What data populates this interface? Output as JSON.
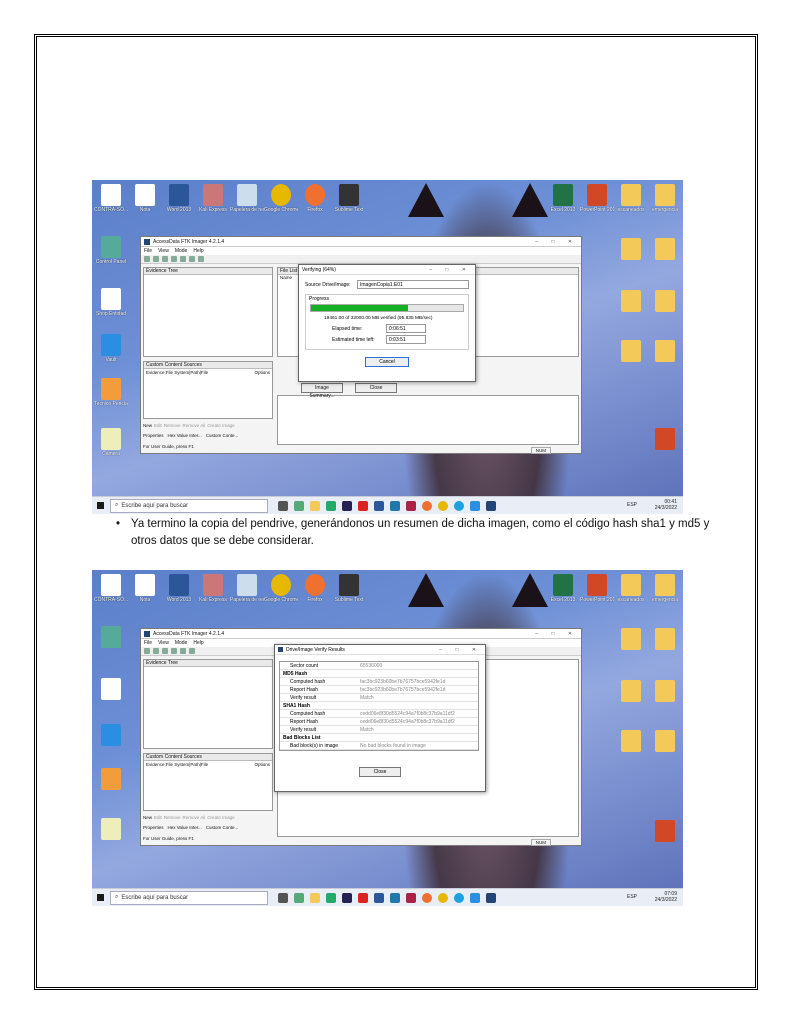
{
  "screenshot1": {
    "desktop_icons_top": [
      "CONTRA-SO...",
      "Nota",
      "Word 2013",
      "Kali Express",
      "Papelera de reciclaje",
      "Google Chrome",
      "Firefox",
      "Sublime Text"
    ],
    "desktop_icons_right": [
      "Excel 2013",
      "PowerPoint 2013",
      "escaneados",
      "emergencia"
    ],
    "left_column_icons": [
      "Control Panel",
      "Shop Entidad",
      "Vault",
      "Tecnico Pericia",
      "Camera"
    ],
    "ftk": {
      "title": "AccessData FTK Imager 4.2.1.4",
      "menu": [
        "File",
        "View",
        "Mode",
        "Help"
      ],
      "evidence_tree": "Evidence Tree",
      "custom_sources": "Custom Content Sources",
      "custom_cols": [
        "Evidence:File System|Path|File",
        "Options"
      ],
      "custom_buttons": [
        "New",
        "Edit",
        "Remove",
        "Remove All",
        "Create Image"
      ],
      "prop_tabs": [
        "Properties",
        "Hex Value Inter...",
        "Custom Conte..."
      ],
      "status": "For User Guide, press F1",
      "file_list": "File List",
      "name_col": "Name",
      "num": "NUM"
    },
    "verify_dialog": {
      "title": "Verifying (64%)",
      "source_label": "Source Drive/Image:",
      "source_value": "ImagenCopia1.E01",
      "progress_label": "Progress",
      "progress_fraction": 0.64,
      "mb_line": "19461.00 of 32000.00 MB verified (95.835 MB/sec)",
      "elapsed_label": "Elapsed time:",
      "elapsed_value": "0:06:51",
      "estimated_label": "Estimated time left:",
      "estimated_value": "0:03:51",
      "cancel": "Cancel"
    },
    "behind_buttons": [
      "Image Summary...",
      "Close"
    ],
    "taskbar": {
      "search": "Escribe aquí para buscar",
      "tray_lang": "ESP",
      "time": "00:41",
      "date": "24/3/2022"
    }
  },
  "caption": "Ya termino la copia del pendrive, generándonos un resumen de dicha imagen, como el código hash sha1 y md5 y otros datos que se debe considerar.",
  "screenshot2": {
    "ftk_title": "AccessData FTK Imager 4.2.1.4",
    "results": {
      "title": "Drive/Image Verify Results",
      "rows": [
        {
          "k": "Sector count",
          "v": "65536000",
          "group": false
        },
        {
          "k": "MD5 Hash",
          "v": "",
          "group": true
        },
        {
          "k": "Computed hash",
          "v": "fac3bc923b60be7b76757bce5942fe1d",
          "group": false
        },
        {
          "k": "Report Hash",
          "v": "fac3bc923b60be7b76757bce5942fe1d",
          "group": false
        },
        {
          "k": "Verify result",
          "v": "Match",
          "group": false
        },
        {
          "k": "SHA1 Hash",
          "v": "",
          "group": true
        },
        {
          "k": "Computed hash",
          "v": "cedd06e8f30d5524c94a7f0b8c37b9a11df2",
          "group": false
        },
        {
          "k": "Report Hash",
          "v": "cedd06e8f30d5524c94a7f0b8c37b9a11df2",
          "group": false
        },
        {
          "k": "Verify result",
          "v": "Match",
          "group": false
        },
        {
          "k": "Bad Blocks List",
          "v": "",
          "group": true
        },
        {
          "k": "Bad block(s) in image",
          "v": "No bad blocks found in image",
          "group": false
        }
      ],
      "close": "Close"
    },
    "taskbar": {
      "search": "Escribe aquí para buscar",
      "tray_lang": "ESP",
      "time": "07:09",
      "date": "24/3/2022"
    }
  },
  "colors": {
    "progress": "#16b026",
    "desktop": "#6d8fd6"
  }
}
